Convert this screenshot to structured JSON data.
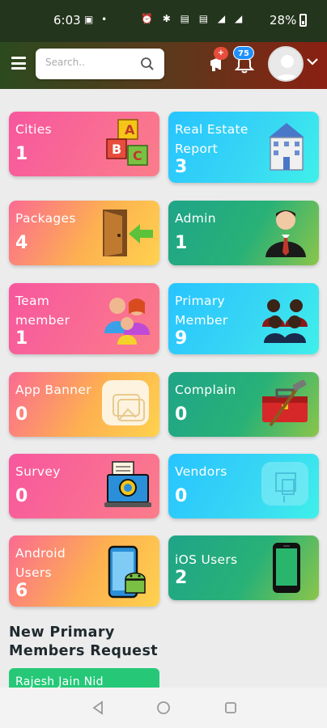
{
  "status_bar": {
    "time": "6:03",
    "battery": "28%"
  },
  "header": {
    "search_placeholder": "Search..",
    "notification_badge": "+",
    "bell_count": "75"
  },
  "cards": [
    {
      "label": "Cities",
      "count": "1",
      "icon": "abc-blocks-icon"
    },
    {
      "label": "Real Estate Report",
      "count": "3",
      "icon": "building-icon"
    },
    {
      "label": "Packages",
      "count": "4",
      "icon": "door-enter-icon"
    },
    {
      "label": "Admin",
      "count": "1",
      "icon": "admin-user-icon"
    },
    {
      "label": "Team member",
      "count": "1",
      "icon": "team-family-icon"
    },
    {
      "label": "Primary Member",
      "count": "9",
      "icon": "group-people-icon"
    },
    {
      "label": "App Banner",
      "count": "0",
      "icon": "banner-image-icon"
    },
    {
      "label": "Complain",
      "count": "0",
      "icon": "toolbox-icon"
    },
    {
      "label": "Survey",
      "count": "0",
      "icon": "survey-laptop-icon"
    },
    {
      "label": "Vendors",
      "count": "0",
      "icon": "vendor-store-icon"
    },
    {
      "label": "Android Users",
      "count": "6",
      "icon": "android-phone-icon"
    },
    {
      "label": "iOS Users",
      "count": "2",
      "icon": "iphone-icon"
    }
  ],
  "section": {
    "title_line1": "New Primary",
    "title_line2": "Members Request"
  },
  "requests": [
    {
      "name": "Rajesh Jain Nid"
    }
  ],
  "colors": {
    "pink": "#f7579e",
    "orange": "#ffd24e",
    "cyan": "#27c4ff",
    "green": "#1fa488"
  }
}
